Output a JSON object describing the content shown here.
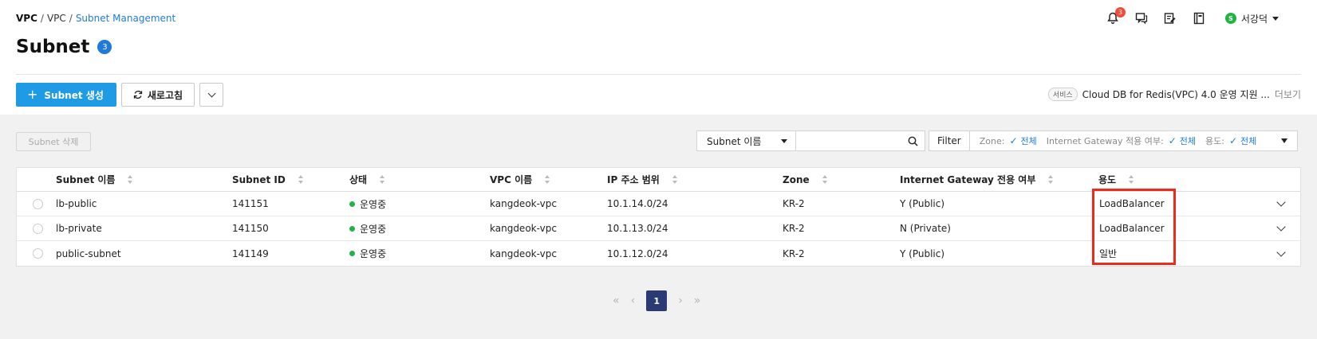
{
  "breadcrumb": {
    "b1": "VPC",
    "b2": "VPC",
    "b3": "Subnet Management",
    "sep": "/"
  },
  "header": {
    "notification_count": "3",
    "user_initial": "S",
    "user_name": "서강덕"
  },
  "page": {
    "title": "Subnet",
    "count": "3"
  },
  "toolbar": {
    "create_plus": "+",
    "create_label": "Subnet 생성",
    "refresh_label": "새로고침"
  },
  "notice": {
    "tag": "서비스",
    "text": "Cloud DB for Redis(VPC) 4.0 운영 지원 ...",
    "more": "더보기"
  },
  "actions": {
    "delete_label": "Subnet 삭제"
  },
  "filter": {
    "select_value": "Subnet 이름",
    "button": "Filter",
    "chips": [
      {
        "label": "Zone:",
        "value": "전체"
      },
      {
        "label": "Internet Gateway 적용 여부:",
        "value": "전체"
      },
      {
        "label": "용도:",
        "value": "전체"
      }
    ]
  },
  "table": {
    "columns": [
      "Subnet 이름",
      "Subnet ID",
      "상태",
      "VPC 이름",
      "IP 주소 범위",
      "Zone",
      "Internet Gateway 전용 여부",
      "용도"
    ],
    "rows": [
      {
        "name": "lb-public",
        "id": "141151",
        "status": "운영중",
        "vpc": "kangdeok-vpc",
        "ip": "10.1.14.0/24",
        "zone": "KR-2",
        "igw": "Y (Public)",
        "usage": "LoadBalancer"
      },
      {
        "name": "lb-private",
        "id": "141150",
        "status": "운영중",
        "vpc": "kangdeok-vpc",
        "ip": "10.1.13.0/24",
        "zone": "KR-2",
        "igw": "N (Private)",
        "usage": "LoadBalancer"
      },
      {
        "name": "public-subnet",
        "id": "141149",
        "status": "운영중",
        "vpc": "kangdeok-vpc",
        "ip": "10.1.12.0/24",
        "zone": "KR-2",
        "igw": "Y (Public)",
        "usage": "일반"
      }
    ]
  },
  "pagination": {
    "first": "«",
    "prev": "‹",
    "current": "1",
    "next": "›",
    "last": "»"
  },
  "colors": {
    "primary": "#1f9be5",
    "link": "#1f7ad9",
    "status_ok": "#22b14c",
    "highlight": "#ee2a1a",
    "page_active": "#2b3a75"
  }
}
